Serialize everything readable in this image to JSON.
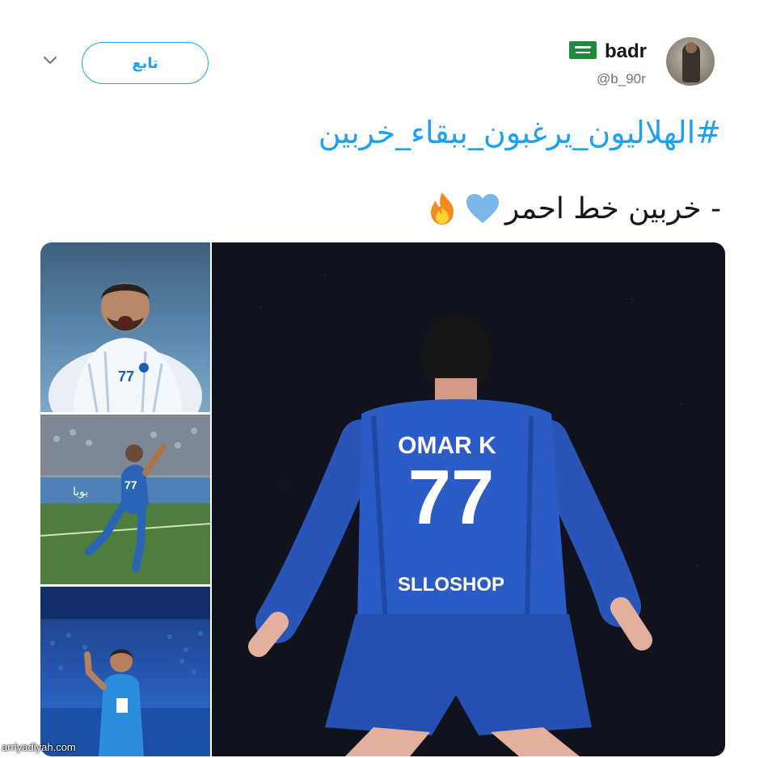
{
  "user": {
    "display_name": "badr",
    "handle": "@b_90r",
    "flag_icon": "saudi-flag-icon"
  },
  "actions": {
    "follow_label": "تابع",
    "more_icon": "chevron-down-icon"
  },
  "tweet": {
    "hashtag": "#الهلاليون_يرغبون_ببقاء_خربين",
    "text": "- خربين خط احمر",
    "emojis": [
      "blue-heart-icon",
      "fire-icon"
    ]
  },
  "media": {
    "main_image": {
      "jersey_name": "OMAR K",
      "jersey_number": "77",
      "sponsor": "SLLOSHOP"
    },
    "thumbnails": [
      {
        "name": "player-celebrating-white-kit"
      },
      {
        "name": "player-running-on-pitch"
      },
      {
        "name": "player-waving-to-crowd"
      }
    ]
  },
  "watermark": "arriyadiyah.com",
  "colors": {
    "accent": "#1da1f2",
    "text": "#14171a",
    "muted": "#657786"
  }
}
